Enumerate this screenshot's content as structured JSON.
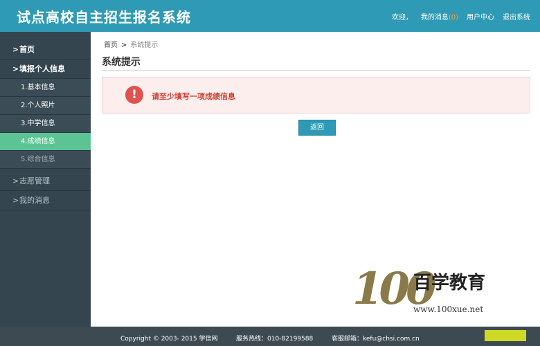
{
  "header": {
    "title": "试点高校自主招生报名系统",
    "nav": {
      "welcome": "欢迎，",
      "messages_label": "我的消息",
      "messages_count": "(0)",
      "user_center": "用户中心",
      "logout": "退出系统"
    }
  },
  "sidebar": {
    "home": "首页",
    "fill_info": "填报个人信息",
    "sub_items": [
      "1.基本信息",
      "2.个人照片",
      "3.中学信息",
      "4.成绩信息",
      "5.综合信息"
    ],
    "wish_mgmt": "志愿管理",
    "my_messages": "我的消息",
    "arrow": ">"
  },
  "breadcrumb": {
    "home": "首页",
    "separator": ">",
    "current": "系统提示"
  },
  "main": {
    "title": "系统提示",
    "alert_icon": "!",
    "alert_message": "请至少填写一项成绩信息",
    "back_button": "返回"
  },
  "footer": {
    "copyright": "Copyright © 2003- 2015 学信网",
    "hotline": "服务热线：010-82199588",
    "email": "客服邮箱：kefu@chsi.com.cn"
  },
  "watermark": {
    "number": "100",
    "brand": "百学教育",
    "url": "www.100xue.net"
  },
  "colors": {
    "header_bg": "#2f9ab5",
    "sidebar_bg": "#35454f",
    "active_item": "#5cc494",
    "alert_bg": "#fdeeee",
    "alert_text": "#d23c2f"
  }
}
